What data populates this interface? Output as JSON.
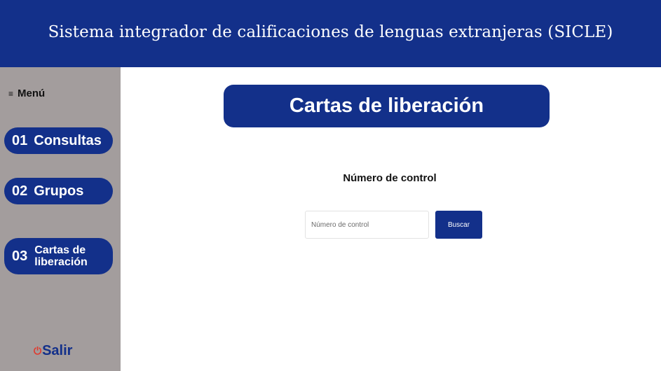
{
  "header": {
    "title": "Sistema integrador de calificaciones de lenguas extranjeras (SICLE)"
  },
  "sidebar": {
    "menu_icon": "hamburger-icon",
    "menu_glyph": "≡",
    "menu_label": "Menú",
    "items": [
      {
        "number": "01",
        "label": "Consultas"
      },
      {
        "number": "02",
        "label": "Grupos"
      },
      {
        "number": "03",
        "label": "Cartas de liberación"
      }
    ],
    "logout": {
      "icon": "power-icon",
      "glyph": "⏻",
      "label": "Salir"
    }
  },
  "main": {
    "title": "Cartas de liberación",
    "field_label": "Número de control",
    "search": {
      "placeholder": "Número de control",
      "value": "",
      "button_label": "Buscar"
    }
  },
  "colors": {
    "brand_blue": "#13308a",
    "sidebar_gray": "#a39d9d",
    "power_red": "#e03a2e"
  }
}
